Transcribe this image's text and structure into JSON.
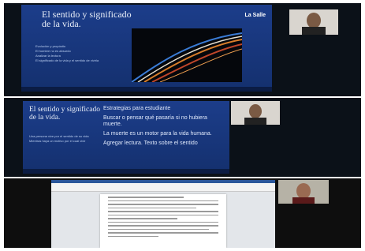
{
  "presenter": {
    "title": "El sentido y significado de la vida.",
    "logo": "La Salle",
    "bullets1": [
      "Evolución y propósito",
      "El hombre no es absurdo",
      "Analizar la lectura",
      "El significado de la vida y el sentido de vivirla"
    ],
    "bullets2": [
      "Una persona vive por el sentido de su vida",
      "Mientras haya un motivo por el cual vivir"
    ],
    "main_points": [
      "Estrategias para estudiante",
      "Buscar o pensar qué pasaría si no hubiera muerte.",
      "La muerte es un motor para la vida humana.",
      "Agregar lectura. Texto sobre el sentido"
    ]
  },
  "colors": {
    "slide_blue": "#1c3d8a",
    "word_blue": "#2b579a"
  },
  "icons": [
    "webcam-feed",
    "la-salle-logo"
  ]
}
